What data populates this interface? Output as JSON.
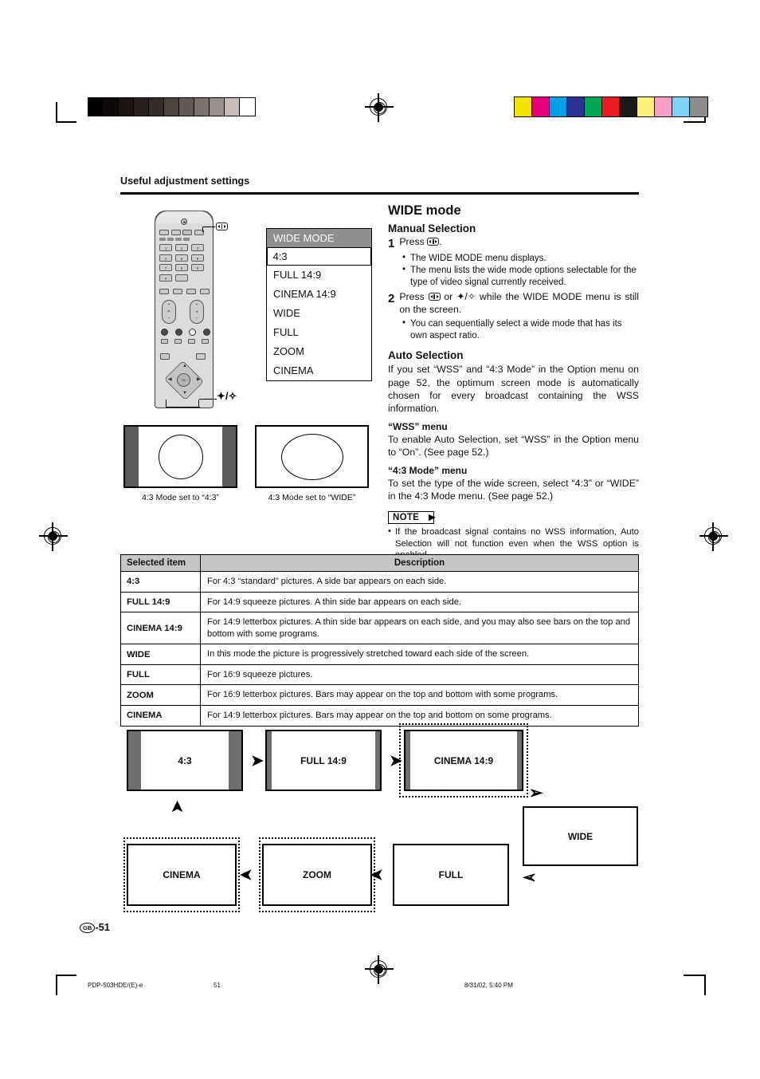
{
  "document": {
    "section_header": "Useful adjustment settings",
    "page_label": "-51",
    "region_mark": "GB"
  },
  "footer": {
    "file_id": "PDP-503HDE/(E)-e",
    "page_number": "51",
    "timestamp": "8/31/02, 5:40 PM"
  },
  "remote": {
    "wide_button_callout": "wide-button",
    "updown_callout": "✦/✧",
    "numbers": [
      "1",
      "2",
      "3",
      "4",
      "5",
      "6",
      "7",
      "8",
      "9",
      "0"
    ],
    "center_label": "OK"
  },
  "osd_menu": {
    "title": "WIDE MODE",
    "selected": "4:3",
    "items": [
      "4:3",
      "FULL 14:9",
      "CINEMA 14:9",
      "WIDE",
      "FULL",
      "ZOOM",
      "CINEMA"
    ]
  },
  "main": {
    "title": "WIDE mode",
    "manual_selection": {
      "heading": "Manual Selection",
      "steps": [
        {
          "num": "1",
          "text_before": "Press",
          "text_after": ".",
          "bullets": [
            "The WIDE MODE menu displays.",
            "The menu lists the wide mode options selectable for the type of video signal currently received."
          ]
        },
        {
          "num": "2",
          "text_before": "Press",
          "text_mid": "or",
          "text_after": "while the WIDE MODE menu is still on the screen.",
          "updown": "✦/✧",
          "bullets": [
            "You can sequentially select a wide mode that has its own aspect ratio."
          ]
        }
      ]
    },
    "auto_selection": {
      "heading": "Auto Selection",
      "body": "If you set “WSS” and “4:3 Mode” in the Option menu on page 52, the optimum screen mode is automatically chosen for every broadcast containing the WSS information."
    },
    "wss_menu": {
      "heading": "“WSS” menu",
      "body": "To enable Auto Selection, set “WSS” in the Option menu to “On”. (See page 52.)"
    },
    "mode43_menu": {
      "heading": "“4:3 Mode” menu",
      "body": "To set the type of the wide screen, select “4:3” or “WIDE” in the 4:3 Mode menu. (See page 52.)"
    },
    "note": {
      "label": "NOTE",
      "items": [
        "If the broadcast signal contains no WSS information, Auto Selection will not function even when the WSS option is enabled."
      ]
    }
  },
  "tv_figures": [
    {
      "caption": "4:3 Mode set to “4:3”",
      "has_sidebars": true,
      "shape": "circle"
    },
    {
      "caption": "4:3 Mode set to “WIDE”",
      "has_sidebars": false,
      "shape": "ellipse"
    }
  ],
  "table": {
    "headers": [
      "Selected item",
      "Description"
    ],
    "rows": [
      {
        "item": "4:3",
        "description": "For 4:3 “standard” pictures. A side bar appears on each side."
      },
      {
        "item": "FULL 14:9",
        "description": "For 14:9 squeeze pictures. A thin side bar appears on each side."
      },
      {
        "item": "CINEMA 14:9",
        "description": "For 14:9 letterbox pictures. A thin side bar appears on each side, and you may also see bars on the top and bottom with some programs."
      },
      {
        "item": "WIDE",
        "description": "In this mode the picture is progressively stretched toward each side of the screen."
      },
      {
        "item": "FULL",
        "description": "For 16:9 squeeze pictures."
      },
      {
        "item": "ZOOM",
        "description": "For 16:9 letterbox pictures. Bars may appear on the top and bottom with some programs."
      },
      {
        "item": "CINEMA",
        "description": "For 14:9 letterbox pictures. Bars may appear on the top and bottom on some programs."
      }
    ]
  },
  "flow_diagram": {
    "nodes": [
      {
        "label": "4:3",
        "dashed": false,
        "sidebars": "wide"
      },
      {
        "label": "FULL 14:9",
        "dashed": false,
        "sidebars": "thin"
      },
      {
        "label": "CINEMA 14:9",
        "dashed": true,
        "sidebars": "thin"
      },
      {
        "label": "WIDE",
        "dashed": false,
        "sidebars": "none"
      },
      {
        "label": "FULL",
        "dashed": false,
        "sidebars": "none"
      },
      {
        "label": "ZOOM",
        "dashed": true,
        "sidebars": "none"
      },
      {
        "label": "CINEMA",
        "dashed": true,
        "sidebars": "none"
      }
    ],
    "arrows": [
      "➤",
      "➤",
      "↘",
      "↙",
      "⬅",
      "⬅",
      "⬆"
    ]
  },
  "print_marks": {
    "gray_wedge": [
      "#000000",
      "#0d0909",
      "#1a1413",
      "#272020",
      "#352c2a",
      "#4c423f",
      "#635853",
      "#7d716c",
      "#9c8f89",
      "#c9bdb7",
      "#ffffff"
    ],
    "color_bars": [
      "#f5e400",
      "#e6007e",
      "#00a0e9",
      "#2e3192",
      "#00a651",
      "#ed1c24",
      "#1a1a1a",
      "#fff27a",
      "#f7a0c6",
      "#7fd4f4",
      "#8c8c8c"
    ]
  }
}
